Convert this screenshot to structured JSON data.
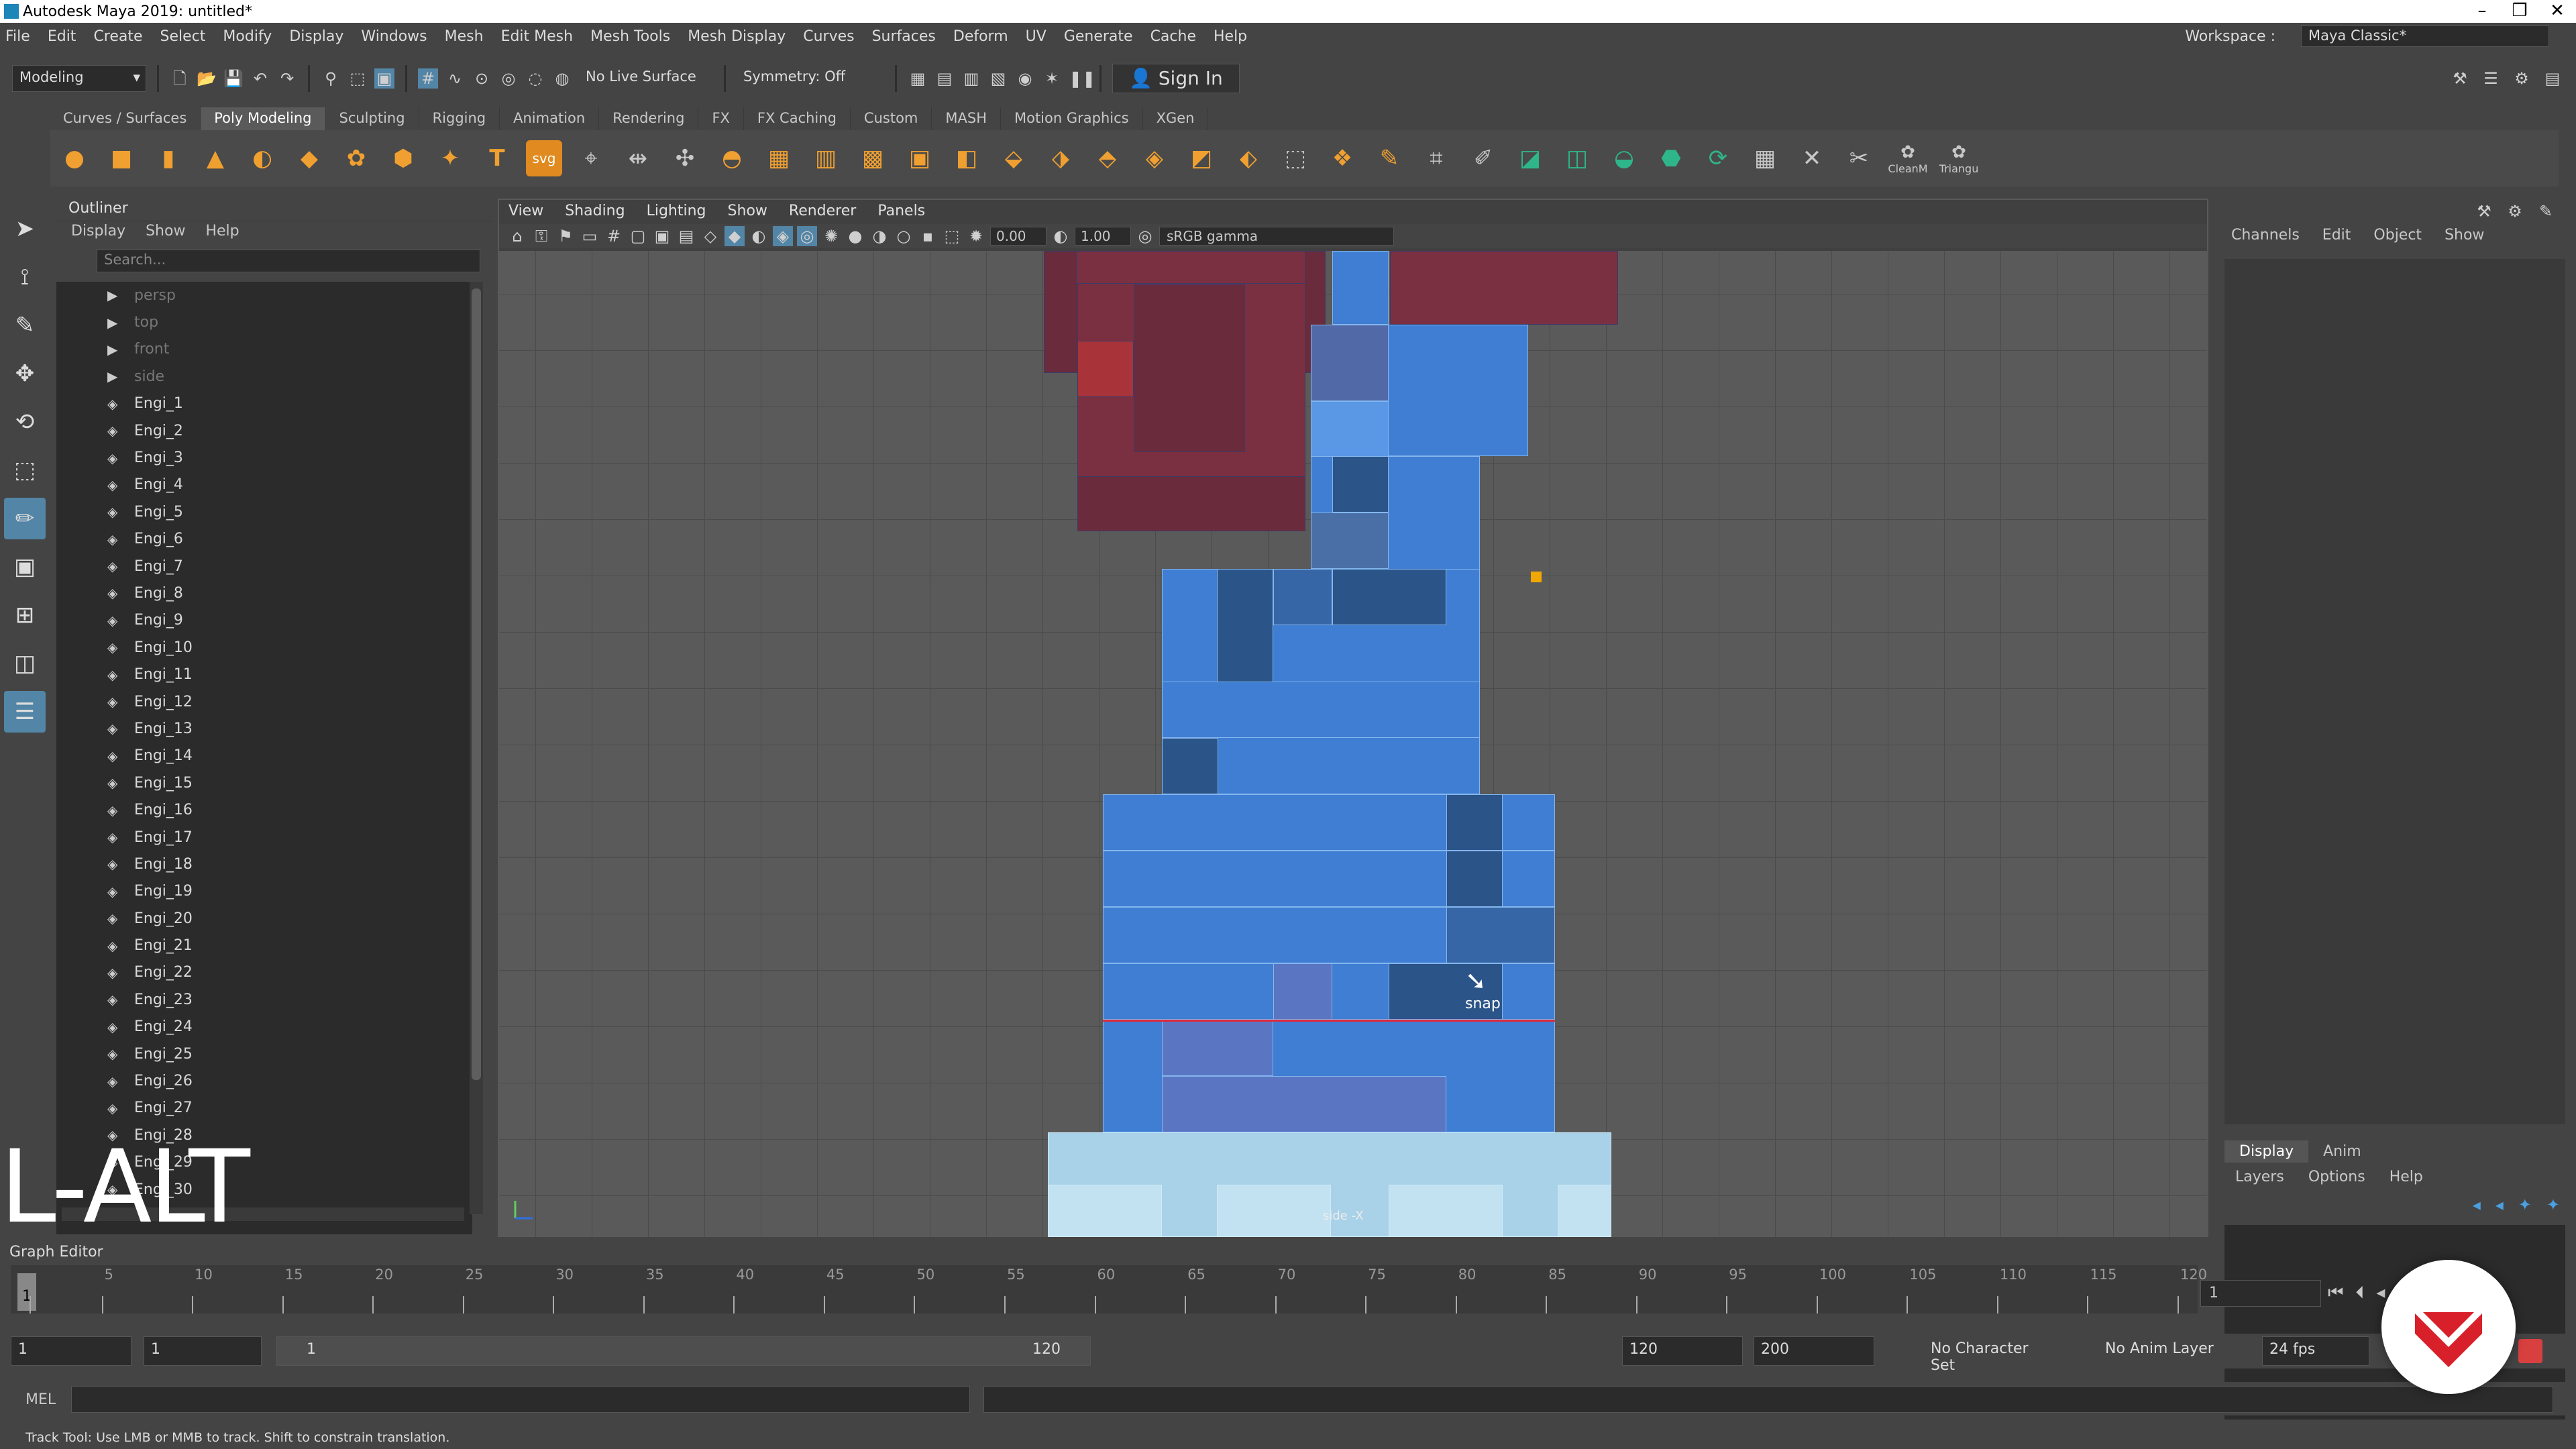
{
  "window": {
    "title": "Autodesk Maya 2019: untitled*"
  },
  "menubar": [
    "File",
    "Edit",
    "Create",
    "Select",
    "Modify",
    "Display",
    "Windows",
    "Mesh",
    "Edit Mesh",
    "Mesh Tools",
    "Mesh Display",
    "Curves",
    "Surfaces",
    "Deform",
    "UV",
    "Generate",
    "Cache",
    "Help"
  ],
  "workspace": {
    "label": "Workspace :",
    "value": "Maya Classic*"
  },
  "statusline": {
    "mode": "Modeling",
    "live_surface": "No Live Surface",
    "symmetry": "Symmetry: Off",
    "signin": "Sign In"
  },
  "shelf_tabs": [
    "Curves / Surfaces",
    "Poly Modeling",
    "Sculpting",
    "Rigging",
    "Animation",
    "Rendering",
    "FX",
    "FX Caching",
    "Custom",
    "MASH",
    "Motion Graphics",
    "XGen"
  ],
  "shelf_active": "Poly Modeling",
  "shelf_labels": {
    "cleanup": "CleanM",
    "triangulate": "Triangu"
  },
  "outliner": {
    "title": "Outliner",
    "menu": [
      "Display",
      "Show",
      "Help"
    ],
    "search_placeholder": "Search...",
    "cameras": [
      "persp",
      "top",
      "front",
      "side"
    ],
    "items": [
      "Engi_1",
      "Engi_2",
      "Engi_3",
      "Engi_4",
      "Engi_5",
      "Engi_6",
      "Engi_7",
      "Engi_8",
      "Engi_9",
      "Engi_10",
      "Engi_11",
      "Engi_12",
      "Engi_13",
      "Engi_14",
      "Engi_15",
      "Engi_16",
      "Engi_17",
      "Engi_18",
      "Engi_19",
      "Engi_20",
      "Engi_21",
      "Engi_22",
      "Engi_23",
      "Engi_24",
      "Engi_25",
      "Engi_26",
      "Engi_27",
      "Engi_28",
      "Engi_29",
      "Engi_30"
    ]
  },
  "key_overlay": "L-ALT",
  "viewport": {
    "menu": [
      "View",
      "Shading",
      "Lighting",
      "Show",
      "Renderer",
      "Panels"
    ],
    "exposure": "0.00",
    "gamma": "1.00",
    "colorspace": "sRGB gamma",
    "cursor_label": "snap",
    "camera_label": "side -X"
  },
  "channelbox": {
    "menu": [
      "Channels",
      "Edit",
      "Object",
      "Show"
    ]
  },
  "layers": {
    "tabs": [
      "Display",
      "Anim"
    ],
    "menu": [
      "Layers",
      "Options",
      "Help"
    ]
  },
  "graph_editor": "Graph Editor",
  "timeline": {
    "ticks": [
      "1",
      "5",
      "10",
      "15",
      "20",
      "25",
      "30",
      "35",
      "40",
      "45",
      "50",
      "55",
      "60",
      "65",
      "70",
      "75",
      "80",
      "85",
      "90",
      "95",
      "100",
      "105",
      "110",
      "115",
      "120"
    ],
    "current": "1",
    "frame_field": "1"
  },
  "range": {
    "start": "1",
    "start_inner": "1",
    "slider_start": "1",
    "slider_end": "120",
    "end_inner": "120",
    "end": "200",
    "character_set": "No Character Set",
    "anim_layer": "No Anim Layer",
    "fps": "24 fps"
  },
  "mel": {
    "label": "MEL"
  },
  "help_line": "Track Tool: Use LMB or MMB to track. Shift to constrain translation.",
  "colors": {
    "selection": "#5285a6",
    "red_block": "#7a3040",
    "blue_block": "#3f7ed2",
    "light_block": "#a9d1e8",
    "logo": "#d8202a"
  }
}
